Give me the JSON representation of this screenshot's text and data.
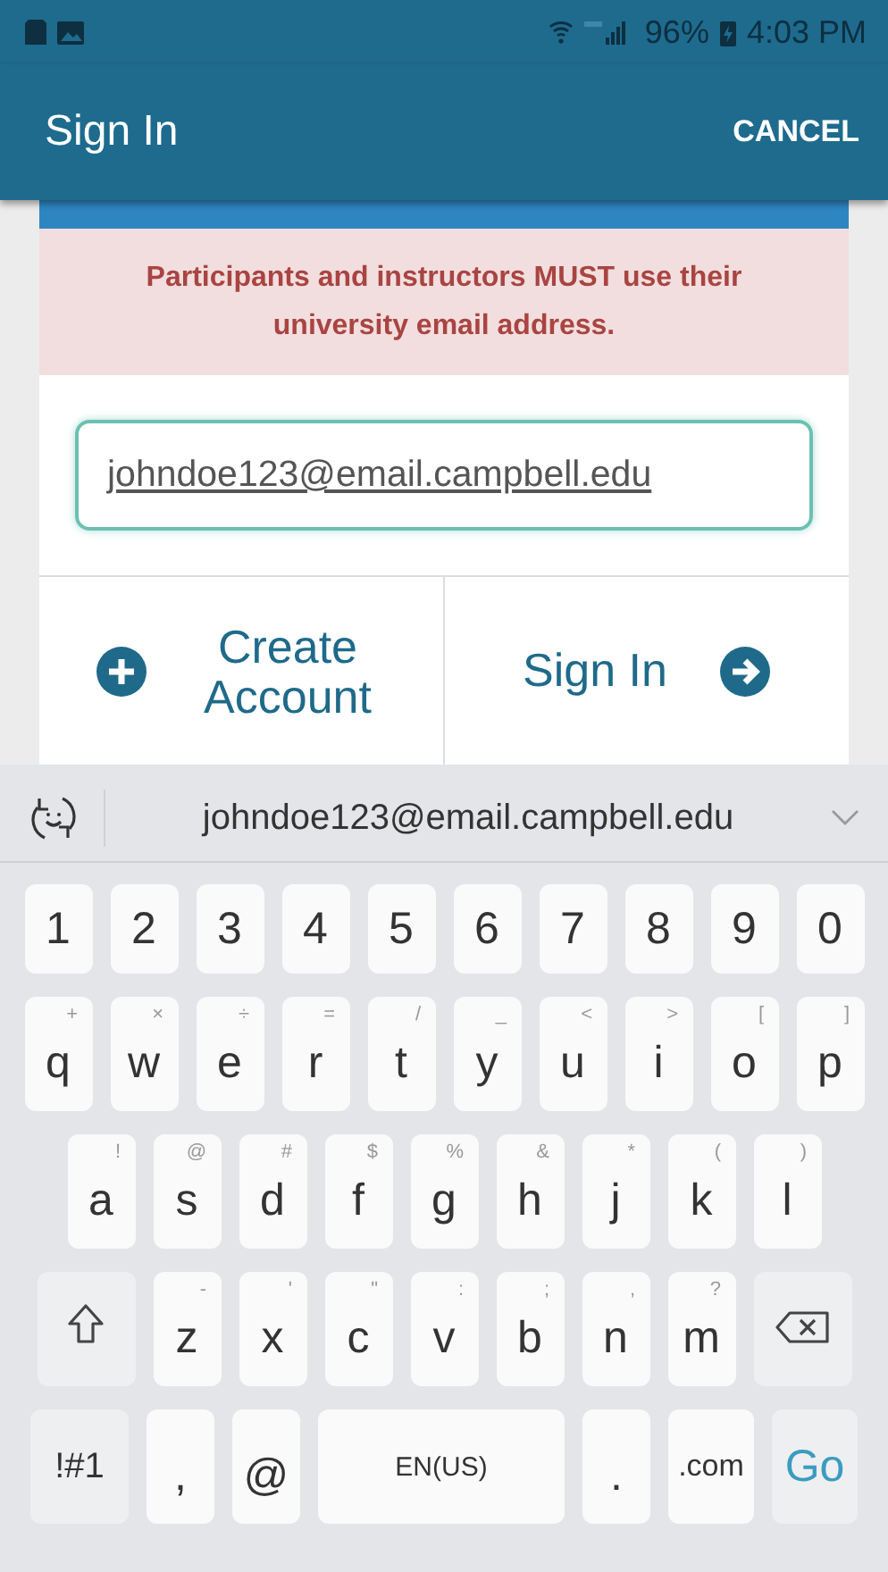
{
  "status_bar": {
    "battery": "96%",
    "time": "4:03 PM"
  },
  "app_bar": {
    "title": "Sign In",
    "action": "CANCEL"
  },
  "notice": "Participants and instructors MUST use their university email address.",
  "email_field": {
    "value": "johndoe123@email.campbell.edu"
  },
  "buttons": [
    {
      "kind": "create",
      "label": "Create Account"
    },
    {
      "kind": "signin",
      "label": "Sign In"
    }
  ],
  "keyboard": {
    "suggestion": "johndoe123@email.campbell.edu",
    "number_row": [
      {
        "kind": "num",
        "label": "1"
      },
      {
        "kind": "num",
        "label": "2"
      },
      {
        "kind": "num",
        "label": "3"
      },
      {
        "kind": "num",
        "label": "4"
      },
      {
        "kind": "num",
        "label": "5"
      },
      {
        "kind": "num",
        "label": "6"
      },
      {
        "kind": "num",
        "label": "7"
      },
      {
        "kind": "num",
        "label": "8"
      },
      {
        "kind": "num",
        "label": "9"
      },
      {
        "kind": "num",
        "label": "0"
      }
    ],
    "top_row": [
      {
        "kind": "char",
        "label": "q",
        "hint": "+"
      },
      {
        "kind": "char",
        "label": "w",
        "hint": "×"
      },
      {
        "kind": "char",
        "label": "e",
        "hint": "÷"
      },
      {
        "kind": "char",
        "label": "r",
        "hint": "="
      },
      {
        "kind": "char",
        "label": "t",
        "hint": "/"
      },
      {
        "kind": "char",
        "label": "y",
        "hint": "_"
      },
      {
        "kind": "char",
        "label": "u",
        "hint": "<"
      },
      {
        "kind": "char",
        "label": "i",
        "hint": ">"
      },
      {
        "kind": "char",
        "label": "o",
        "hint": "["
      },
      {
        "kind": "char",
        "label": "p",
        "hint": "]"
      }
    ],
    "home_row": [
      {
        "kind": "char",
        "label": "a",
        "hint": "!"
      },
      {
        "kind": "char",
        "label": "s",
        "hint": "@"
      },
      {
        "kind": "char",
        "label": "d",
        "hint": "#"
      },
      {
        "kind": "char",
        "label": "f",
        "hint": "$"
      },
      {
        "kind": "char",
        "label": "g",
        "hint": "%"
      },
      {
        "kind": "char",
        "label": "h",
        "hint": "&"
      },
      {
        "kind": "char",
        "label": "j",
        "hint": "*"
      },
      {
        "kind": "char",
        "label": "k",
        "hint": "("
      },
      {
        "kind": "char",
        "label": "l",
        "hint": ")"
      }
    ],
    "bottom_row": [
      {
        "kind": "shift"
      },
      {
        "kind": "char",
        "label": "z",
        "hint": "-"
      },
      {
        "kind": "char",
        "label": "x",
        "hint": "'"
      },
      {
        "kind": "char",
        "label": "c",
        "hint": "\""
      },
      {
        "kind": "char",
        "label": "v",
        "hint": ":"
      },
      {
        "kind": "char",
        "label": "b",
        "hint": ";"
      },
      {
        "kind": "char",
        "label": "n",
        "hint": ","
      },
      {
        "kind": "char",
        "label": "m",
        "hint": "?"
      },
      {
        "kind": "backspace"
      }
    ],
    "function_row": [
      {
        "kind": "mode",
        "label": "!#1"
      },
      {
        "kind": "char",
        "label": ","
      },
      {
        "kind": "char",
        "label": "@"
      },
      {
        "kind": "space",
        "label": "EN(US)"
      },
      {
        "kind": "char",
        "label": "."
      },
      {
        "kind": "domain",
        "label": ".com"
      },
      {
        "kind": "go",
        "label": "Go"
      }
    ]
  }
}
